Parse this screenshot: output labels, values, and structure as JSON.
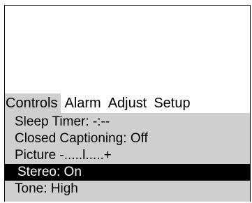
{
  "menubar": {
    "tabs": [
      {
        "label": "Controls",
        "active": true
      },
      {
        "label": "Alarm",
        "active": false
      },
      {
        "label": "Adjust",
        "active": false
      },
      {
        "label": "Setup",
        "active": false
      }
    ]
  },
  "controls_menu": {
    "items": [
      {
        "label": "Sleep Timer:  -:--",
        "selected": false
      },
      {
        "label": "Closed Captioning: Off",
        "selected": false
      },
      {
        "label": "Picture  -.....l.....+",
        "selected": false
      },
      {
        "label": "Stereo: On",
        "selected": true
      },
      {
        "label": "Tone: High",
        "selected": false
      }
    ]
  },
  "colors": {
    "background": "#ffffff",
    "panel": "#cfcfcf",
    "selection_bg": "#000000",
    "selection_fg": "#ffffff"
  }
}
